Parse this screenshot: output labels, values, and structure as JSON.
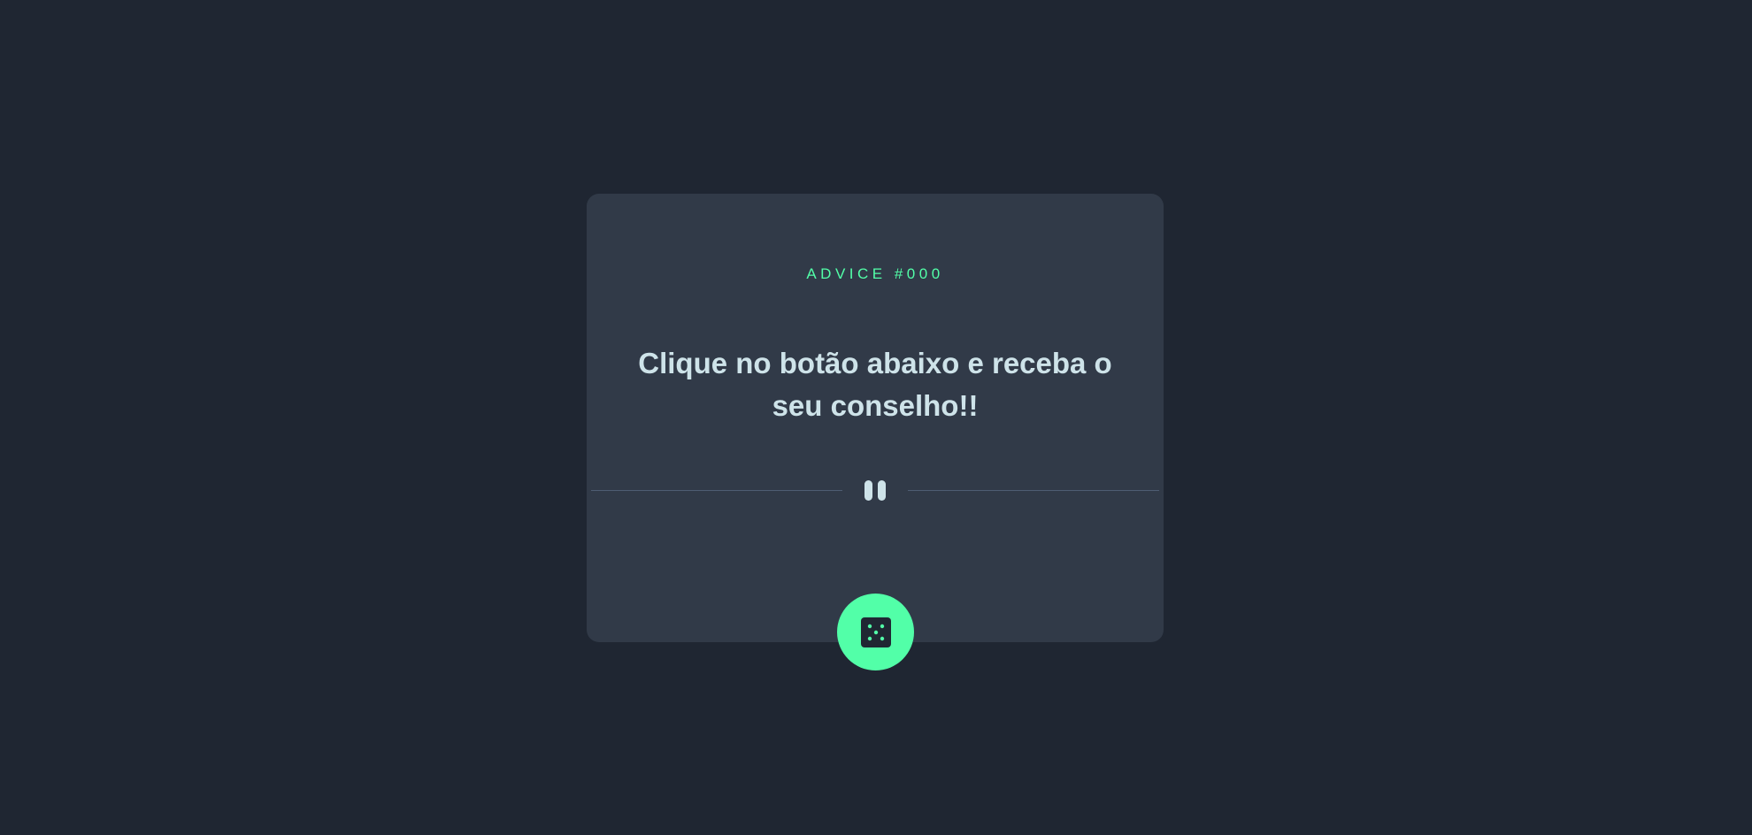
{
  "advice": {
    "id_label": "ADVICE #000",
    "text": "Clique no botão abaixo e receba o seu conselho!!"
  },
  "icons": {
    "divider": "pause-icon",
    "button": "dice-icon"
  },
  "colors": {
    "background": "#1f2632",
    "card": "#313a48",
    "accent": "#52ffa8",
    "text": "#cee3e9",
    "divider": "#4e5d73"
  }
}
